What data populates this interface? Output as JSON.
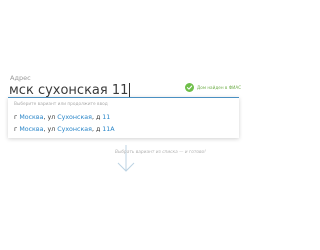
{
  "address_field": {
    "label": "Адрес",
    "value": "мск сухонская 11"
  },
  "fias_status": {
    "text": "Дом найден в ФИАС",
    "icon": "check-circle-icon",
    "color": "#6fbf4a"
  },
  "suggestions": {
    "hint": "Выберите вариант или продолжите ввод",
    "items": [
      {
        "prefix": "г ",
        "city": "Москва",
        "mid": ", ул ",
        "street": "Сухонская",
        "house_prefix": ", д ",
        "house": "11"
      },
      {
        "prefix": "г ",
        "city": "Москва",
        "mid": ", ул ",
        "street": "Сухонская",
        "house_prefix": ", д ",
        "house": "11А"
      }
    ],
    "highlight_color": "#2a86c9"
  },
  "instruction": {
    "text": "Выбрать вариант из списка — и готово!",
    "icon": "arrow-down-icon"
  }
}
